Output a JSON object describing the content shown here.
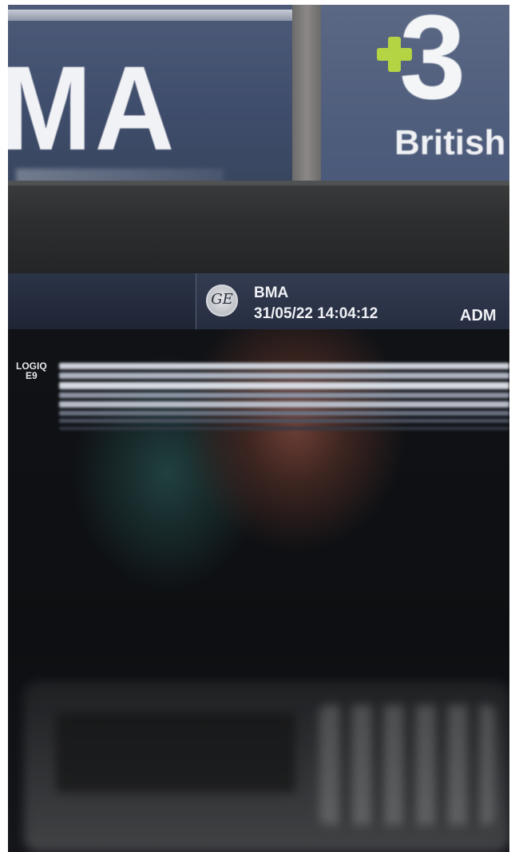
{
  "banners": {
    "left_text": "MA",
    "right_numeral": "3",
    "right_brand_text": "British",
    "plus_color": "#b4d443"
  },
  "screen": {
    "header": {
      "logo_text": "GE",
      "name": "BMA",
      "datetime": "31/05/22 14:04:12",
      "user": "ADM"
    },
    "model_line1": "LOGIQ",
    "model_line2": "E9"
  }
}
